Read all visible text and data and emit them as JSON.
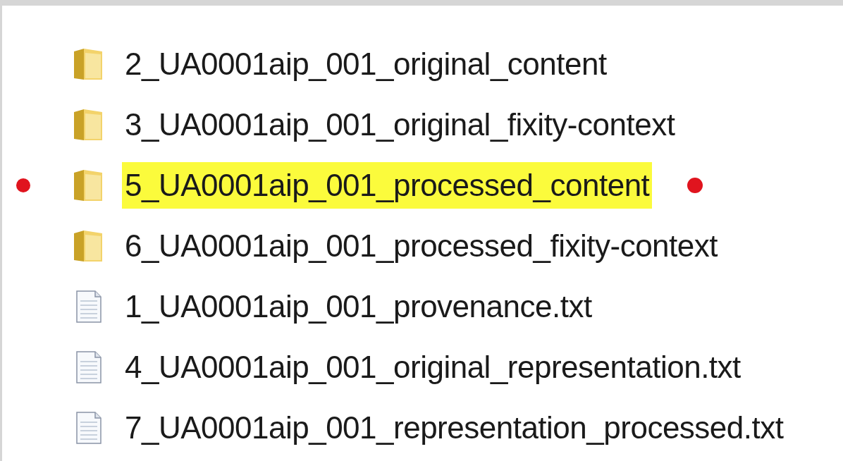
{
  "files": [
    {
      "kind": "folder",
      "name": "2_UA0001aip_001_original_content",
      "highlighted": false
    },
    {
      "kind": "folder",
      "name": "3_UA0001aip_001_original_fixity-context",
      "highlighted": false
    },
    {
      "kind": "folder",
      "name": "5_UA0001aip_001_processed_content",
      "highlighted": true
    },
    {
      "kind": "folder",
      "name": "6_UA0001aip_001_processed_fixity-context",
      "highlighted": false
    },
    {
      "kind": "text",
      "name": "1_UA0001aip_001_provenance.txt",
      "highlighted": false
    },
    {
      "kind": "text",
      "name": "4_UA0001aip_001_original_representation.txt",
      "highlighted": false
    },
    {
      "kind": "text",
      "name": "7_UA0001aip_001_representation_processed.txt",
      "highlighted": false
    }
  ]
}
